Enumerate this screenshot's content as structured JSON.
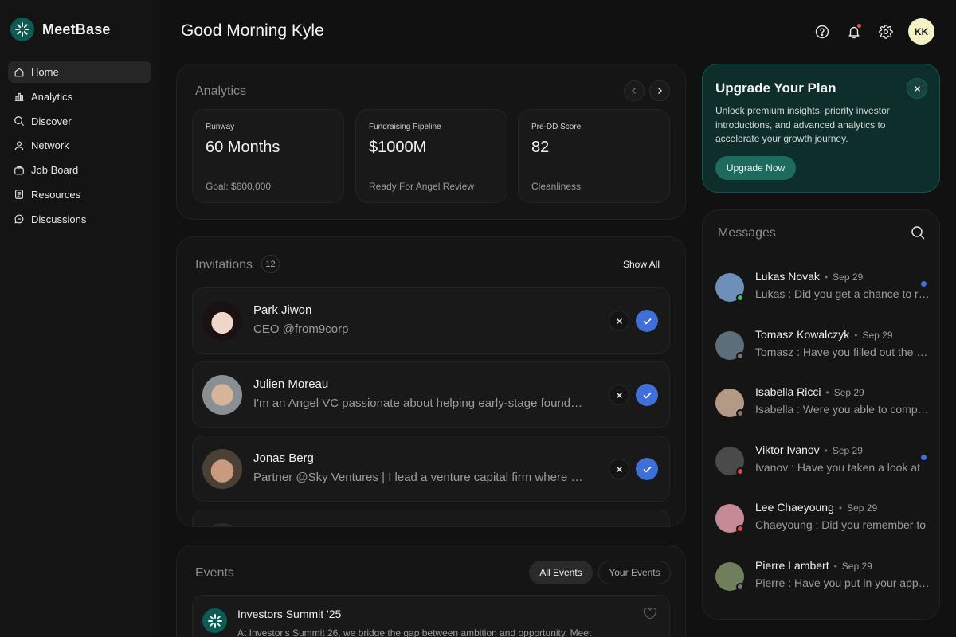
{
  "app": {
    "name": "MeetBase"
  },
  "sidebar": {
    "items": [
      {
        "label": "Home",
        "icon": "home-icon",
        "active": true
      },
      {
        "label": "Analytics",
        "icon": "bar-chart-icon"
      },
      {
        "label": "Discover",
        "icon": "search-icon"
      },
      {
        "label": "Network",
        "icon": "user-icon"
      },
      {
        "label": "Job Board",
        "icon": "briefcase-icon"
      },
      {
        "label": "Resources",
        "icon": "document-icon"
      },
      {
        "label": "Discussions",
        "icon": "chat-bubble-icon"
      }
    ]
  },
  "header": {
    "greeting": "Good Morning Kyle",
    "avatar_initials": "KK",
    "icons": [
      "help-icon",
      "bell-icon",
      "gear-icon"
    ]
  },
  "analytics": {
    "title": "Analytics",
    "stats": [
      {
        "label": "Runway",
        "value": "60 Months",
        "sub": "Goal: $600,000"
      },
      {
        "label": "Fundraising Pipeline",
        "value": "$1000M",
        "sub": "Ready For Angel Review"
      },
      {
        "label": "Pre-DD Score",
        "value": "82",
        "sub": "Cleanliness"
      }
    ]
  },
  "invitations": {
    "title": "Invitations",
    "count": "12",
    "show_all": "Show All",
    "items": [
      {
        "name": "Park Jiwon",
        "desc": "CEO @from9corp"
      },
      {
        "name": "Julien Moreau",
        "desc": "I'm an Angel VC passionate about helping early-stage founders grow"
      },
      {
        "name": "Jonas Berg",
        "desc": "Partner @Sky Ventures | I lead a venture capital firm where we back"
      }
    ]
  },
  "events": {
    "title": "Events",
    "tabs": {
      "all": "All Events",
      "yours": "Your Events"
    },
    "item": {
      "name": "Investors Summit '25",
      "desc": "At Investor's Summit 26, we bridge the gap between ambition and opportunity. Meet"
    }
  },
  "upgrade": {
    "title": "Upgrade Your Plan",
    "body": "Unlock premium insights, priority investor introductions, and advanced analytics to accelerate your growth journey.",
    "cta": "Upgrade Now"
  },
  "messages": {
    "title": "Messages",
    "items": [
      {
        "name": "Lukas Novak",
        "date": "Sep 29",
        "preview": "Lukas : Did you get a chance to review",
        "status": "online",
        "unread": true,
        "avatar_color": "#6d8fb8"
      },
      {
        "name": "Tomasz Kowalczyk",
        "date": "Sep 29",
        "preview": "Tomasz : Have you filled out the form",
        "status": "offline",
        "unread": false,
        "avatar_color": "#5c6e7a"
      },
      {
        "name": "Isabella Ricci",
        "date": "Sep 29",
        "preview": "Isabella : Were you able to complete",
        "status": "offline",
        "unread": false,
        "avatar_color": "#b39a84"
      },
      {
        "name": "Viktor Ivanov",
        "date": "Sep 29",
        "preview": "Ivanov : Have you taken a look at",
        "status": "busy",
        "unread": true,
        "avatar_color": "#4a4a4a"
      },
      {
        "name": "Lee Chaeyoung",
        "date": "Sep 29",
        "preview": "Chaeyoung : Did you remember to",
        "status": "busy",
        "unread": false,
        "avatar_color": "#c48a96"
      },
      {
        "name": "Pierre Lambert",
        "date": "Sep 29",
        "preview": "Pierre : Have you put in your application",
        "status": "offline",
        "unread": false,
        "avatar_color": "#6f7f5c"
      }
    ]
  },
  "colors": {
    "accent_blue": "#3f6fd8",
    "upgrade_bg": "#0d2e2a",
    "upgrade_button": "#1d6a5f",
    "online": "#3fbf5f",
    "busy": "#e04848",
    "offline": "#777777"
  }
}
